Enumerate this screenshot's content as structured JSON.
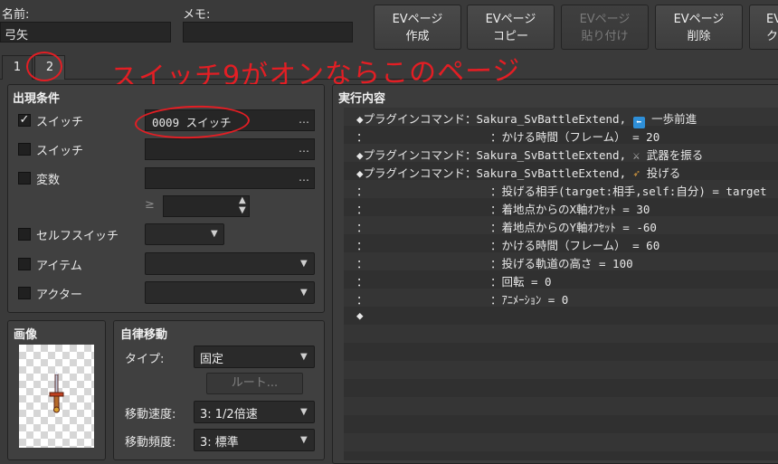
{
  "header": {
    "name_label": "名前:",
    "name_value": "弓矢",
    "memo_label": "メモ:",
    "memo_value": ""
  },
  "ev_buttons": [
    {
      "line1": "EVページ",
      "line2": "作成",
      "enabled": true
    },
    {
      "line1": "EVページ",
      "line2": "コピー",
      "enabled": true
    },
    {
      "line1": "EVページ",
      "line2": "貼り付け",
      "enabled": false
    },
    {
      "line1": "EVページ",
      "line2": "削除",
      "enabled": true
    },
    {
      "line1": "EV",
      "line2": "ク",
      "enabled": true
    }
  ],
  "tabs": [
    "1",
    "2"
  ],
  "annotation": "スイッチ9がオンならこのページ",
  "conditions": {
    "title": "出現条件",
    "switch1_label": "スイッチ",
    "switch1_checked": true,
    "switch1_value": "0009 スイッチ",
    "switch2_label": "スイッチ",
    "variable_label": "変数",
    "ge_symbol": "≥",
    "self_switch_label": "セルフスイッチ",
    "item_label": "アイテム",
    "actor_label": "アクター",
    "ellipsis": "…"
  },
  "image": {
    "title": "画像",
    "sprite_icon": "sword-icon"
  },
  "autonomous": {
    "title": "自律移動",
    "type_label": "タイプ:",
    "type_value": "固定",
    "route_button": "ルート...",
    "speed_label": "移動速度:",
    "speed_value": "3: 1/2倍速",
    "freq_label": "移動頻度:",
    "freq_value": "3: 標準"
  },
  "contents": {
    "title": "実行内容",
    "lines": [
      "◆プラグインコマンド：Sakura_SvBattleExtend, ",
      "：                  ：かける時間（フレーム） = 20",
      "◆プラグインコマンド：Sakura_SvBattleExtend, ",
      "◆プラグインコマンド：Sakura_SvBattleExtend, ",
      "：                  ：投げる相手(target:相手,self:自分) = target",
      "：                  ：着地点からのX軸ｵﾌｾｯﾄ = 30",
      "：                  ：着地点からのY軸ｵﾌｾｯﾄ = -60",
      "：                  ：かける時間（フレーム） = 60",
      "：                  ：投げる軌道の高さ = 100",
      "：                  ：回転 = 0",
      "：                  ：ｱﾆﾒｰｼｮﾝ = 0",
      "◆"
    ],
    "line1_suffix": "一歩前進",
    "line3_suffix": "武器を振る",
    "line4_suffix": "投げる"
  },
  "colors": {
    "annotation": "#e31e24",
    "accent_blue": "#2e8fd8"
  }
}
